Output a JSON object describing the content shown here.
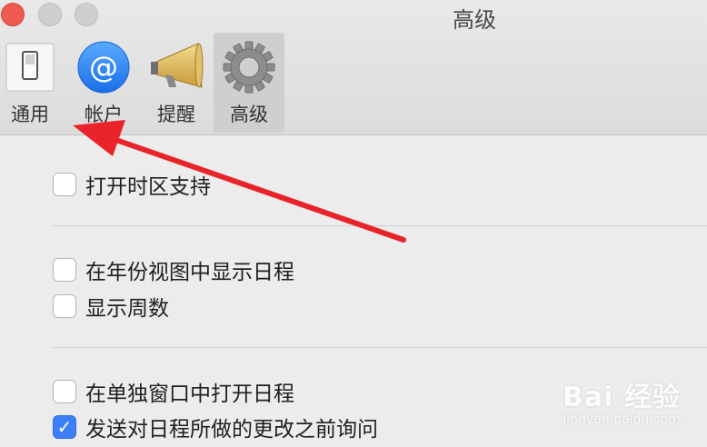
{
  "window": {
    "title": "高级"
  },
  "toolbar": {
    "items": [
      {
        "label": "通用",
        "icon": "switch-icon"
      },
      {
        "label": "帐户",
        "icon": "at-sign-icon"
      },
      {
        "label": "提醒",
        "icon": "megaphone-icon"
      },
      {
        "label": "高级",
        "icon": "gear-icon",
        "selected": true
      }
    ]
  },
  "options": {
    "timezone_support": {
      "label": "打开时区支持",
      "checked": false
    },
    "show_events_year_view": {
      "label": "在年份视图中显示日程",
      "checked": false
    },
    "show_week_numbers": {
      "label": "显示周数",
      "checked": false
    },
    "open_events_separate_window": {
      "label": "在单独窗口中打开日程",
      "checked": false
    },
    "ask_before_sending_changes": {
      "label": "发送对日程所做的更改之前询问",
      "checked": true
    }
  },
  "watermark": {
    "main": "Bai 经验",
    "sub": "jingyan.baidu.com"
  },
  "colors": {
    "accent": "#3d7ff6",
    "annotation_arrow": "#e8232a",
    "close_button": "#ee5a52"
  }
}
